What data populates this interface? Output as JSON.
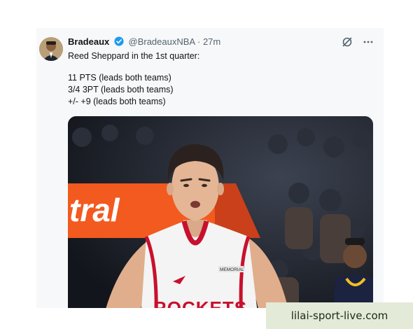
{
  "tweet": {
    "display_name": "Bradeaux",
    "handle": "@BradeauxNBA",
    "separator": "·",
    "time": "27m",
    "lines": [
      "Reed Sheppard in the 1st quarter:",
      "11 PTS (leads both teams)",
      "3/4 3PT (leads both teams)",
      "+/- +9 (leads both teams)"
    ],
    "icons": [
      "verified-badge-icon",
      "grok-icon",
      "more-icon"
    ]
  },
  "media": {
    "arena_sign_text": "tral",
    "jersey_text": "ROCKETS",
    "jersey_patch": "MEMORIAL",
    "colors": {
      "jersey": "#f4f4f4",
      "trim": "#c8102e",
      "sign": "#f25a1f"
    }
  },
  "watermark": {
    "text": "lilai-sport-live.com"
  }
}
